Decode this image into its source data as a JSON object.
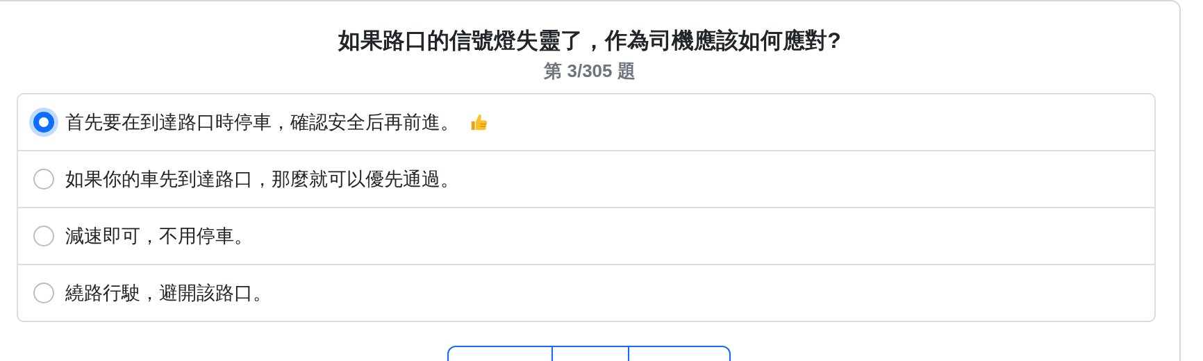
{
  "question": {
    "title": "如果路口的信號燈失靈了，作為司機應該如何應對?",
    "counter": "第 3/305 題"
  },
  "options": [
    {
      "label": "首先要在到達路口時停車，確認安全后再前進。",
      "selected": true,
      "kind": "approved"
    },
    {
      "label": "如果你的車先到達路口，那麼就可以優先通過。",
      "selected": false,
      "kind": "plain"
    },
    {
      "label": "減速即可，不用停車。",
      "selected": false,
      "kind": "plain"
    },
    {
      "label": "繞路行駛，避開該路口。",
      "selected": false,
      "kind": "plain"
    }
  ],
  "pager": [
    {
      "kind": "first"
    },
    {
      "kind": "middle"
    },
    {
      "kind": "last"
    }
  ]
}
